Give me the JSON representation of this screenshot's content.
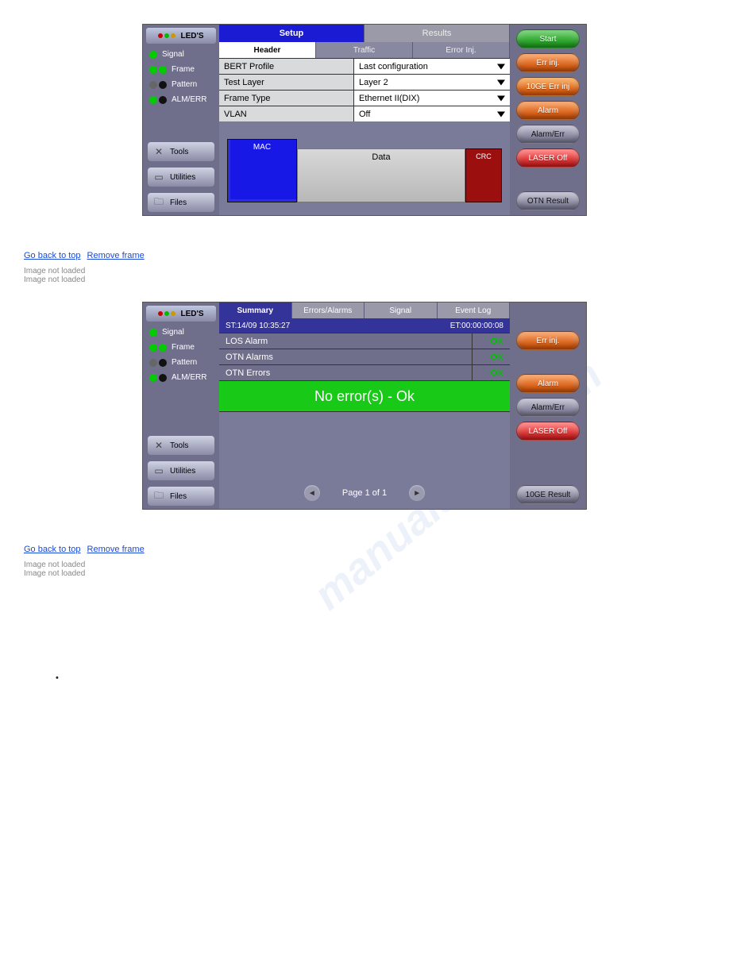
{
  "watermark": "manualshive.com",
  "shot1": {
    "sidebar": {
      "header": "LED'S",
      "leds": [
        {
          "dots": [
            "grn"
          ],
          "label": "Signal"
        },
        {
          "dots": [
            "grn",
            "grn"
          ],
          "label": "Frame"
        },
        {
          "dots": [
            "gry",
            "blk"
          ],
          "label": "Pattern"
        },
        {
          "dots": [
            "grn",
            "blk"
          ],
          "label": "ALM/ERR"
        }
      ],
      "buttons": [
        {
          "icon": "tools-icon",
          "label": "Tools"
        },
        {
          "icon": "utilities-icon",
          "label": "Utilities"
        },
        {
          "icon": "files-icon",
          "label": "Files"
        }
      ]
    },
    "top_tabs": [
      {
        "label": "Setup",
        "active": true
      },
      {
        "label": "Results",
        "active": false
      }
    ],
    "sub_tabs": [
      {
        "label": "Header",
        "active": true
      },
      {
        "label": "Traffic",
        "active": false
      },
      {
        "label": "Error Inj.",
        "active": false
      }
    ],
    "form": [
      {
        "label": "BERT Profile",
        "value": "Last configuration"
      },
      {
        "label": "Test Layer",
        "value": "Layer 2"
      },
      {
        "label": "Frame Type",
        "value": "Ethernet II(DIX)"
      },
      {
        "label": "VLAN",
        "value": "Off"
      }
    ],
    "frame": {
      "mac": "MAC",
      "data": "Data",
      "crc": "CRC"
    },
    "right_buttons": [
      {
        "label": "Start",
        "cls": "green"
      },
      {
        "label": "Err inj.",
        "cls": "orange"
      },
      {
        "label": "10GE Err inj",
        "cls": "teal"
      },
      {
        "label": "Alarm",
        "cls": "orange"
      },
      {
        "label": "Alarm/Err",
        "cls": "gray"
      },
      {
        "label": "LASER Off",
        "cls": "red"
      }
    ],
    "right_bottom": {
      "label": "OTN Result",
      "cls": "gray"
    }
  },
  "links": {
    "go_back": "Go back to top",
    "remove_frame": "Remove frame"
  },
  "not_loaded": "Image not loaded\nImage not loaded",
  "shot2": {
    "sidebar": {
      "header": "LED'S",
      "leds": [
        {
          "dots": [
            "grn"
          ],
          "label": "Signal"
        },
        {
          "dots": [
            "grn",
            "grn"
          ],
          "label": "Frame"
        },
        {
          "dots": [
            "gry",
            "blk"
          ],
          "label": "Pattern"
        },
        {
          "dots": [
            "grn",
            "blk"
          ],
          "label": "ALM/ERR"
        }
      ],
      "buttons": [
        {
          "icon": "tools-icon",
          "label": "Tools"
        },
        {
          "icon": "utilities-icon",
          "label": "Utilities"
        },
        {
          "icon": "files-icon",
          "label": "Files"
        }
      ]
    },
    "tabs": [
      {
        "label": "Summary",
        "active": true
      },
      {
        "label": "Errors/Alarms",
        "active": false
      },
      {
        "label": "Signal",
        "active": false
      },
      {
        "label": "Event Log",
        "active": false
      }
    ],
    "time": {
      "start": "ST:14/09 10:35:27",
      "elapsed": "ET:00:00:00:08"
    },
    "status": [
      {
        "label": "LOS Alarm",
        "value": "OK"
      },
      {
        "label": "OTN Alarms",
        "value": "OK"
      },
      {
        "label": "OTN Errors",
        "value": "OK"
      }
    ],
    "ok_bar": "No error(s) - Ok",
    "pager": {
      "label": "Page 1 of 1"
    },
    "right_buttons": [
      {
        "label": "Err inj.",
        "cls": "orange"
      },
      {
        "label": "Alarm",
        "cls": "orange"
      },
      {
        "label": "Alarm/Err",
        "cls": "gray"
      },
      {
        "label": "LASER Off",
        "cls": "red"
      }
    ],
    "right_bottom": {
      "label": "10GE Result",
      "cls": "gray"
    }
  },
  "bullet": ""
}
